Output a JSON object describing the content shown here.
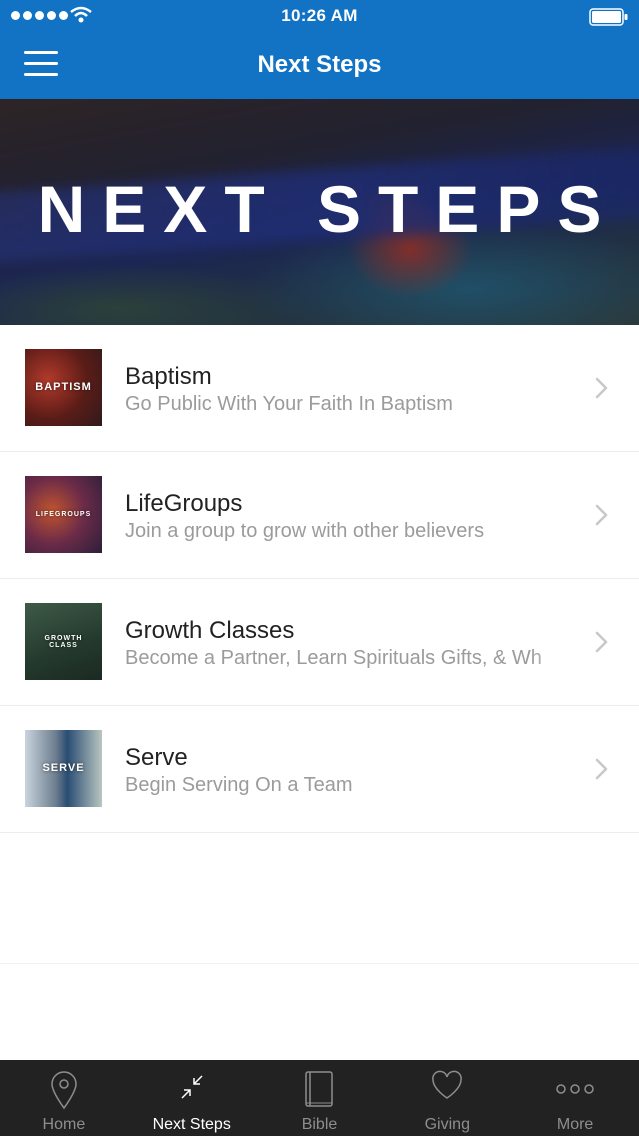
{
  "status_bar": {
    "time": "10:26 AM"
  },
  "nav": {
    "title": "Next Steps"
  },
  "hero": {
    "text": "NEXT STEPS"
  },
  "list": {
    "items": [
      {
        "thumb_label": "BAPTISM",
        "title": "Baptism",
        "subtitle": "Go Public With Your Faith In Baptism"
      },
      {
        "thumb_label": "LIFEGROUPS",
        "title": "LifeGroups",
        "subtitle": "Join a group to grow with other believers"
      },
      {
        "thumb_label": "GROWTH CLASS",
        "title": "Growth Classes",
        "subtitle": "Become a Partner, Learn Spirituals Gifts, & Wh"
      },
      {
        "thumb_label": "SERVE",
        "title": "Serve",
        "subtitle": "Begin Serving On a Team"
      }
    ]
  },
  "tabs": [
    {
      "label": "Home",
      "icon": "map-pin-icon"
    },
    {
      "label": "Next Steps",
      "icon": "arrows-in-icon",
      "active": true
    },
    {
      "label": "Bible",
      "icon": "book-icon"
    },
    {
      "label": "Giving",
      "icon": "heart-icon"
    },
    {
      "label": "More",
      "icon": "more-dots-icon"
    }
  ],
  "colors": {
    "brand_blue": "#1272c4",
    "tab_bar": "#222222",
    "tab_inactive": "#8e8e8e",
    "subtitle_gray": "#9b9b9b"
  }
}
